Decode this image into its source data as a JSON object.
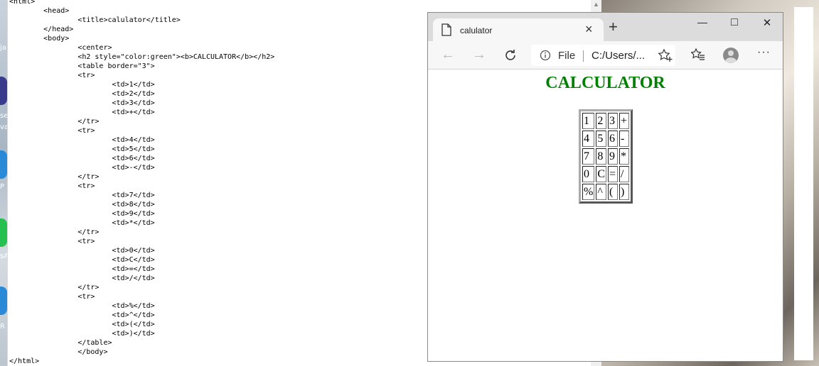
{
  "editor": {
    "lines": [
      "<html>",
      "        <head>",
      "                <title>calulator</title>",
      "        </head>",
      "        <body>",
      "                <center>",
      "                <h2 style=\"color:green\"><b>CALCULATOR</b></h2>",
      "                <table border=\"3\">",
      "                <tr>",
      "                        <td>1</td>",
      "                        <td>2</td>",
      "                        <td>3</td>",
      "                        <td>+</td>",
      "                </tr>",
      "                <tr>",
      "                        <td>4</td>",
      "                        <td>5</td>",
      "                        <td>6</td>",
      "                        <td>-</td>",
      "                </tr>",
      "                <tr>",
      "                        <td>7</td>",
      "                        <td>8</td>",
      "                        <td>9</td>",
      "                        <td>*</td>",
      "                </tr>",
      "                <tr>",
      "                        <td>0</td>",
      "                        <td>C</td>",
      "                        <td>=</td>",
      "                        <td>/</td>",
      "                </tr>",
      "                <tr>",
      "                        <td>%</td>",
      "                        <td>^</td>",
      "                        <td>(</td>",
      "                        <td>)</td>",
      "                </table>",
      "                </body>",
      "</html>"
    ]
  },
  "desktop": {
    "left_fragments": [
      "ja",
      "se",
      "va",
      "P",
      "sA",
      "R"
    ]
  },
  "browser": {
    "tab_title": "calulator",
    "address_scheme": "File",
    "address_url": "C:/Users/...",
    "window_controls": {
      "minimize": "—",
      "maximize": "□",
      "close": "✕"
    },
    "colors": {
      "heading": "#008000",
      "titlebar": "#dcdcdc"
    }
  },
  "page": {
    "heading": "CALCULATOR",
    "table": [
      [
        "1",
        "2",
        "3",
        "+"
      ],
      [
        "4",
        "5",
        "6",
        "-"
      ],
      [
        "7",
        "8",
        "9",
        "*"
      ],
      [
        "0",
        "C",
        "=",
        "/"
      ],
      [
        "%",
        "^",
        "(",
        ")"
      ]
    ]
  }
}
